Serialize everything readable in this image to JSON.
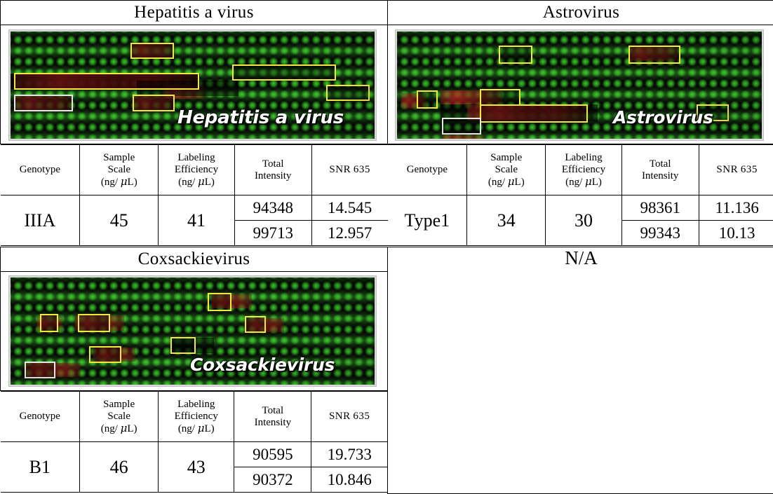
{
  "panels": [
    {
      "id": "hepatitis-a-virus",
      "title": "Hepatitis a  virus",
      "watermark": "Hepatitis a virus",
      "table": {
        "headers": {
          "genotype": "Genotype",
          "sample_scale_l1": "Sample",
          "sample_scale_l2": "Scale",
          "sample_scale_unit_pre": "(ng/ ",
          "sample_scale_unit_mu": "μ",
          "sample_scale_unit_post": "L)",
          "labeling_l1": "Labeling",
          "labeling_l2": "Efficiency",
          "labeling_unit_pre": "(ng/ ",
          "labeling_unit_mu": "μ",
          "labeling_unit_post": "L)",
          "total_intensity_l1": "Total",
          "total_intensity_l2": "Intensity",
          "snr_label": "SNR",
          "snr_num": "635"
        },
        "genotype": "IIIA",
        "sample_scale": "45",
        "labeling_efficiency": "41",
        "rows": [
          {
            "total_intensity": "94348",
            "snr635": "14.545"
          },
          {
            "total_intensity": "99713",
            "snr635": "12.957"
          }
        ]
      }
    },
    {
      "id": "astrovirus",
      "title": "Astrovirus",
      "watermark": "Astrovirus",
      "table": {
        "headers": {
          "genotype": "Genotype",
          "sample_scale_l1": "Sample",
          "sample_scale_l2": "Scale",
          "sample_scale_unit_pre": "(ng/ ",
          "sample_scale_unit_mu": "μ",
          "sample_scale_unit_post": "L)",
          "labeling_l1": "Labeling",
          "labeling_l2": "Efficiency",
          "labeling_unit_pre": "(ng/ ",
          "labeling_unit_mu": "μ",
          "labeling_unit_post": "L)",
          "total_intensity_l1": "Total",
          "total_intensity_l2": "Intensity",
          "snr_label": "SNR",
          "snr_num": "635"
        },
        "genotype": "Type1",
        "sample_scale": "34",
        "labeling_efficiency": "30",
        "rows": [
          {
            "total_intensity": "98361",
            "snr635": "11.136"
          },
          {
            "total_intensity": "99343",
            "snr635": "10.13"
          }
        ]
      }
    },
    {
      "id": "coxsackievirus",
      "title": "Coxsackievirus",
      "watermark": "Coxsackievirus",
      "table": {
        "headers": {
          "genotype": "Genotype",
          "sample_scale_l1": "Sample",
          "sample_scale_l2": "Scale",
          "sample_scale_unit_pre": "(ng/ ",
          "sample_scale_unit_mu": "μ",
          "sample_scale_unit_post": "L)",
          "labeling_l1": "Labeling",
          "labeling_l2": "Efficiency",
          "labeling_unit_pre": "(ng/ ",
          "labeling_unit_mu": "μ",
          "labeling_unit_post": "L)",
          "total_intensity_l1": "Total",
          "total_intensity_l2": "Intensity",
          "snr_label": "SNR",
          "snr_num": "635"
        },
        "genotype": "B1",
        "sample_scale": "46",
        "labeling_efficiency": "43",
        "rows": [
          {
            "total_intensity": "90595",
            "snr635": "19.733"
          },
          {
            "total_intensity": "90372",
            "snr635": "10.846"
          }
        ]
      }
    }
  ],
  "empty_cell": {
    "label": "N/A"
  },
  "colors": {
    "highlight_box": "#f5e73c",
    "control_box": "#e8e8e8",
    "spot_green": "#3ed72c",
    "signal_red": "#b91e1e",
    "array_background": "#050505",
    "border": "#000000"
  }
}
